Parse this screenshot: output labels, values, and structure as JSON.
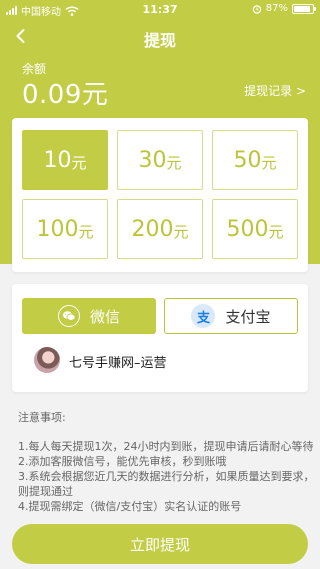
{
  "status_bar": {
    "carrier": "中国移动",
    "time": "11:37",
    "battery_text": "87%",
    "battery_level": 0.87,
    "icons": [
      "signal-icon",
      "wifi-icon",
      "alarm-icon",
      "battery-icon"
    ]
  },
  "header": {
    "title": "提现",
    "back_icon": "chevron-left-icon"
  },
  "balance": {
    "label": "余额",
    "value": "0.09元",
    "records_link": "提现记录 >"
  },
  "amounts": [
    {
      "num": "10",
      "unit": "元",
      "selected": true
    },
    {
      "num": "30",
      "unit": "元",
      "selected": false
    },
    {
      "num": "50",
      "unit": "元",
      "selected": false
    },
    {
      "num": "100",
      "unit": "元",
      "selected": false
    },
    {
      "num": "200",
      "unit": "元",
      "selected": false
    },
    {
      "num": "500",
      "unit": "元",
      "selected": false
    }
  ],
  "payment": {
    "wechat_label": "微信",
    "alipay_label": "支付宝",
    "alipay_glyph": "支",
    "account_name": "七号手赚网–运营"
  },
  "notes": {
    "title": "注意事项:",
    "items": [
      "1.每人每天提现1次，24小时内到账，提现申请后请耐心等待",
      "2.添加客服微信号，能优先审核，秒到账哦",
      "3.系统会根据您近几天的数据进行分析，如果质量达到要求，则提现通过",
      "4.提现需绑定（微信/支付宝）实名认证的账号"
    ]
  },
  "submit_label": "立即提现",
  "colors": {
    "accent": "#c3cc45",
    "accent_text": "#bcc43a",
    "background": "#f2f2f2",
    "alipay_blue": "#1a7ee0"
  }
}
